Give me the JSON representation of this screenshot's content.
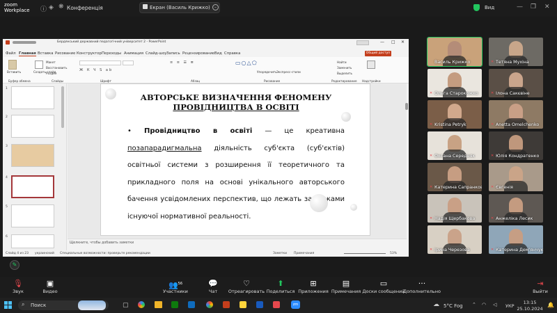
{
  "zoom": {
    "logo_line1": "zoom",
    "logo_line2": "Workplace",
    "conference_label": "Конференція",
    "share_label": "Екран (Василь Крижко)",
    "view_label": "Вид"
  },
  "ppt": {
    "window_title": "Бердянський державний педагогічний університет 2 - PowerPoint",
    "menu": [
      "Файл",
      "Главная",
      "Вставка",
      "Рисование",
      "Конструктор",
      "Переходы",
      "Анимация",
      "Слайд-шоу",
      "Запись",
      "Рецензирование",
      "Вид",
      "Справка"
    ],
    "share_button": "Общий доступ",
    "ribbon_labels": [
      "Вставить",
      "Макет",
      "Восстановить",
      "Раздел",
      "Создать слайд",
      "Буфер обмена",
      "Слайды",
      "Шрифт",
      "Абзац",
      "Упорядочить",
      "Экспресс-стили",
      "Рисование",
      "Найти",
      "Заменить",
      "Выделить",
      "Редактирование",
      "Надстройки"
    ],
    "slide_numbers": [
      "1",
      "2",
      "3",
      "4",
      "5",
      "6"
    ],
    "slide": {
      "title_line1": "АВТОРСЬКЕ ВИЗНАЧЕННЯ ФЕНОМЕНУ",
      "title_line2": "ПРОВІДНИЦТВА В ОСВІТІ",
      "bullet_term": "Провідництво в освіті",
      "body_part1": " — це креативна ",
      "underlined": "позапарадигмальна",
      "body_part2": " діяльність суб'єкта (суб'єктів) освітньої системи з розширення її теоретичного та прикладного поля на основі унікального авторського бачення усвідомлених перспектив, що лежать за межами існуючої нормативної реальності."
    },
    "notes_placeholder": "Щелкните, чтобы добавить заметки",
    "status": {
      "slide_info": "Слайд 4 из 23",
      "language": "украинский",
      "accessibility": "Специальные возможности: проверьте рекомендации",
      "notes": "Заметки",
      "comments": "Примечания",
      "zoom": "53%"
    }
  },
  "participants": [
    {
      "name": "Василь Крижко",
      "muted": false,
      "face": "#b48c78",
      "bg": "#c9a27a"
    },
    {
      "name": "Тетяна Мухіна",
      "muted": true,
      "face": "#c8a68a",
      "bg": "#6d6a64"
    },
    {
      "name": "Ольга Старокожко",
      "muted": true,
      "face": "#c49c80",
      "bg": "#eae6df"
    },
    {
      "name": "Ілона Сакєвіне",
      "muted": true,
      "face": "#caa58c",
      "bg": "#5a4f46"
    },
    {
      "name": "Kristina Petryk",
      "muted": true,
      "face": "#d1a88c",
      "bg": "#7b5e48"
    },
    {
      "name": "Anetta Omelchenko",
      "muted": true,
      "face": "#c99f86",
      "bg": "#8e7a64"
    },
    {
      "name": "Оксана Середняк",
      "muted": true,
      "face": "#c8a284",
      "bg": "#e7e2da"
    },
    {
      "name": "Юлія Кондратенко",
      "muted": true,
      "face": "#bf977c",
      "bg": "#3e3a37"
    },
    {
      "name": "Катерина Сапранкова",
      "muted": true,
      "face": "#c69d82",
      "bg": "#6a5848"
    },
    {
      "name": "Євгенія",
      "muted": true,
      "face": "#caa488",
      "bg": "#a99a8a"
    },
    {
      "name": "Надія Щербакова",
      "muted": true,
      "face": "#c9a086",
      "bg": "#c9c3ba"
    },
    {
      "name": "Анжеліка Лесик",
      "muted": true,
      "face": "#c49b80",
      "bg": "#5e5853"
    },
    {
      "name": "Ірина Черезова",
      "muted": true,
      "face": "#caa38a",
      "bg": "#d8d0c4"
    },
    {
      "name": "Катерина Дем'янчук",
      "muted": true,
      "face": "#c69e84",
      "bg": "#8fa6b8"
    }
  ],
  "toolbar": {
    "audio": "Звук",
    "video": "Видео",
    "participants": "Участники",
    "participants_count": "56",
    "chat": "Чат",
    "react": "Отреагировать",
    "share": "Поделиться",
    "apps": "Приложения",
    "notes": "Примечания",
    "whiteboards": "Доски сообщений",
    "more": "Дополнительно",
    "leave": "Выйти"
  },
  "taskbar": {
    "search": "Поиск",
    "weather": "5°C Fog",
    "lang": "УКР",
    "time": "13:15",
    "date": "25.10.2024"
  },
  "colors": {
    "zoom_green": "#22c55e",
    "leave_red": "#e5484d",
    "ppt_orange": "#c43e1c",
    "highlight_pink": "#a4373a"
  }
}
